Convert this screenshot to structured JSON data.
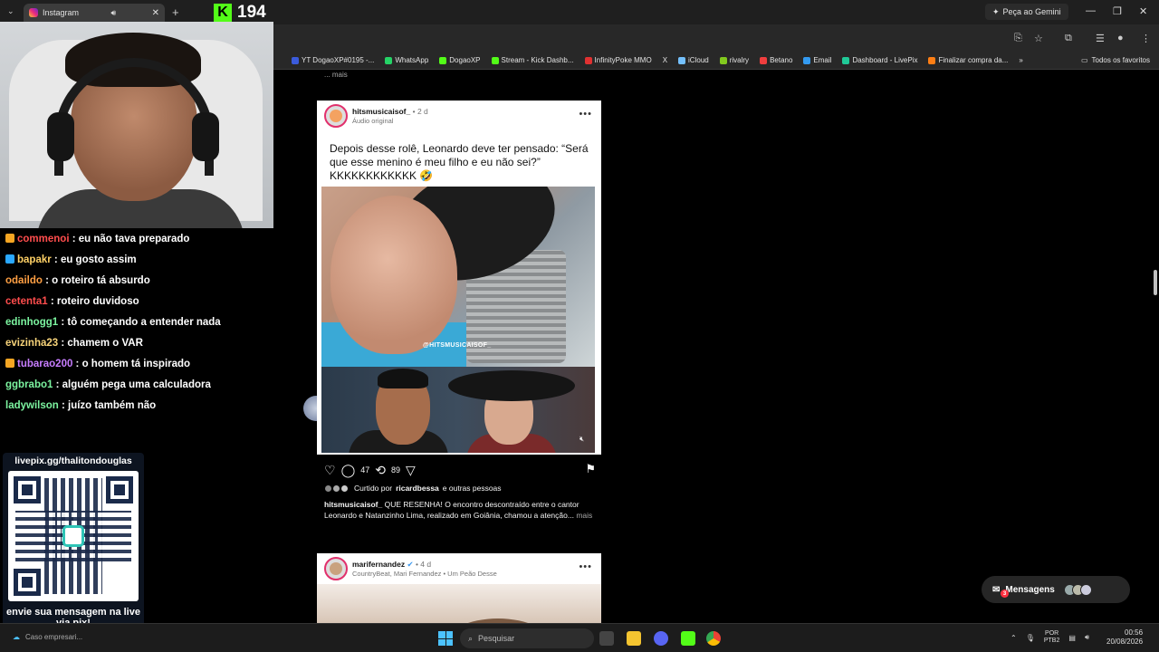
{
  "browser": {
    "tab_title": "Instagram",
    "gemini_label": "Peça ao Gemini",
    "bookmarks": [
      {
        "label": "YT DogaoXP#0195 -...",
        "color": "#3b5bdb"
      },
      {
        "label": "WhatsApp",
        "color": "#25d366"
      },
      {
        "label": "DogaoXP",
        "color": "#53fc18"
      },
      {
        "label": "Stream - Kick Dashb...",
        "color": "#53fc18"
      },
      {
        "label": "InfinityPoke MMO",
        "color": "#e03131"
      },
      {
        "label": "X",
        "color": "#ffffff"
      },
      {
        "label": "iCloud",
        "color": "#74c0fc"
      },
      {
        "label": "rivalry",
        "color": "#82c91e"
      },
      {
        "label": "Betano",
        "color": "#f03e3e"
      },
      {
        "label": "Email",
        "color": "#339af0"
      },
      {
        "label": "Dashboard - LivePix",
        "color": "#20c997"
      },
      {
        "label": "Finalizar compra da...",
        "color": "#fd7e14"
      }
    ],
    "all_favorites": "Todos os favoritos"
  },
  "stream": {
    "kick_count": "194",
    "chat": [
      {
        "user": "commenoi",
        "color": "#ff4d4d",
        "badge": "#f5a623",
        "text": " : eu não tava preparado"
      },
      {
        "user": "bapakr",
        "color": "#ffd166",
        "badge": "#2aa8ff",
        "text": " : eu gosto assim"
      },
      {
        "user": "odaildo",
        "color": "#ff9f43",
        "badge": "",
        "text": " : o roteiro tá absurdo"
      },
      {
        "user": "cetenta1",
        "color": "#ff4d4d",
        "badge": "",
        "text": " : roteiro duvidoso"
      },
      {
        "user": "edinhogg1",
        "color": "#7cf5a0",
        "badge": "",
        "text": " : tô começando a entender nada"
      },
      {
        "user": "evizinha23",
        "color": "#f7d37a",
        "badge": "",
        "text": " : chamem o VAR"
      },
      {
        "user": "tubarao200",
        "color": "#c77dff",
        "badge": "#f5a623",
        "text": " : o homem tá inspirado"
      },
      {
        "user": "ggbrabo1",
        "color": "#7cf5a0",
        "badge": "",
        "text": " : alguém pega uma calculadora"
      },
      {
        "user": "ladywilson",
        "color": "#7cf5a0",
        "badge": "",
        "text": " : juízo também não"
      }
    ],
    "pix_url": "livepix.gg/thalitondouglas",
    "pix_caption": "envie sua mensagem na live via pix!"
  },
  "feed": {
    "prev_more": "... mais",
    "post1": {
      "username": "hitsmusicaisof_",
      "time": " • 2 d",
      "audio": "Áudio original",
      "meme_text": "Depois desse rolê, Leonardo deve ter pensado: “Será que esse menino é meu filho e eu não sei?” KKKKKKKKKKKK 🤣",
      "watermark": "@HITSMUSICAISOF_",
      "comments": "47",
      "reposts": "89",
      "liked_by_prefix": "Curtido por ",
      "liked_by_user": "ricardbessa",
      "liked_by_suffix": " e outras pessoas",
      "caption_user": "hitsmusicaisof_",
      "caption_text": " QUE RESENHA! O encontro descontraído entre o cantor Leonardo e Natanzinho Lima, realizado em Goiânia, chamou a atenção...",
      "caption_more": " mais"
    },
    "post2": {
      "username": "marifernandez",
      "time": " • 4 d",
      "subtitle": "CountryBeat, Mari Fernandez • Um Peão Desse"
    },
    "messages_label": "Mensagens",
    "messages_badge": "3"
  },
  "taskbar": {
    "weather": "Caso empresari...",
    "search_placeholder": "Pesquisar",
    "lang1": "POR",
    "lang2": "PTB2",
    "time": "00:56",
    "date": "20/08/2026"
  }
}
